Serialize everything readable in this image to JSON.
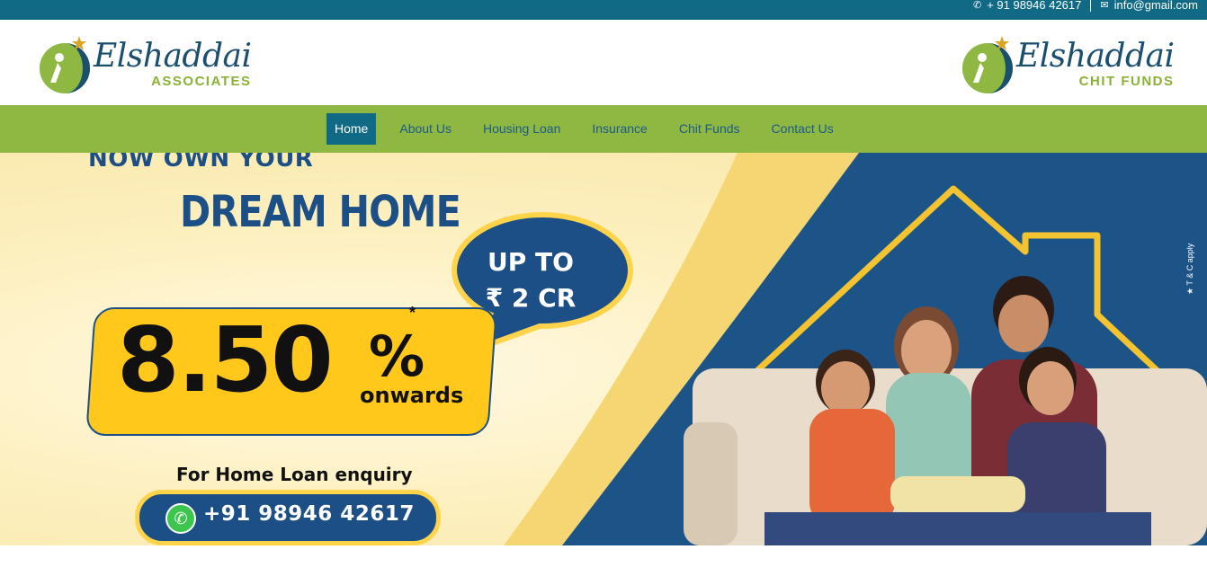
{
  "topbar": {
    "phone": "+ 91 98946 42617",
    "email": "info@gmail.com"
  },
  "header": {
    "logo_left": {
      "brand": "Elshaddai",
      "sub": "ASSOCIATES"
    },
    "logo_right": {
      "brand": "Elshaddai",
      "sub": "CHIT FUNDS"
    }
  },
  "nav": {
    "items": [
      {
        "label": "Home",
        "active": true
      },
      {
        "label": "About Us"
      },
      {
        "label": "Housing Loan"
      },
      {
        "label": "Insurance"
      },
      {
        "label": "Chit Funds"
      },
      {
        "label": "Contact Us"
      }
    ]
  },
  "banner": {
    "headline1": "NOW OWN YOUR",
    "headline2": "DREAM HOME",
    "bubble_line1": "UP TO",
    "bubble_line2": "₹ 2 CR",
    "rate": "8.50",
    "rate_symbol": "%",
    "rate_star": "*",
    "rate_sub": "onwards",
    "enquiry": "For Home Loan enquiry",
    "phone": "+91 98946 42617",
    "tc": "★ T & C apply"
  },
  "colors": {
    "topbar": "#106a86",
    "nav": "#8fb842",
    "brand_blue": "#1c4f86",
    "accent_yellow": "#ffc81a"
  }
}
